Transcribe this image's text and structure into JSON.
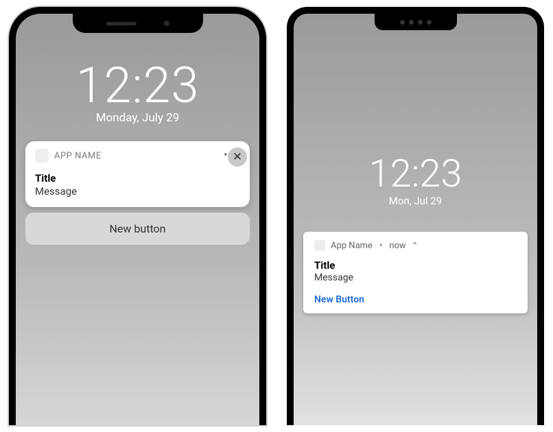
{
  "ios": {
    "time": "12:23",
    "date": "Monday, July 29",
    "close_icon": "✕",
    "notification": {
      "app_name": "APP NAME",
      "more_icon": "•••",
      "title": "Title",
      "message": "Message",
      "action_label": "New button"
    }
  },
  "android": {
    "time": "12:23",
    "date": "Mon, Jul 29",
    "notification": {
      "app_name": "App Name",
      "separator": "•",
      "timestamp": "now",
      "chevron": "⌃",
      "title": "Title",
      "message": "Message",
      "action_label": "New Button"
    }
  }
}
